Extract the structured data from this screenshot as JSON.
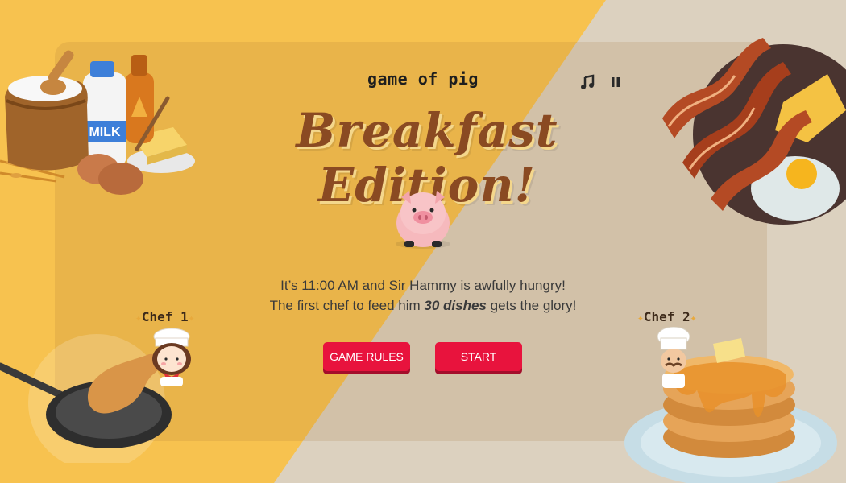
{
  "game_title": "game of pig",
  "headline": "Breakfast Edition!",
  "controls": {
    "music_icon": "music-note-icon",
    "pause_icon": "pause-icon"
  },
  "intro": {
    "line1": "It’s 11:00 AM and Sir Hammy is awfully hungry!",
    "line2_before": "The first chef to feed him ",
    "line2_emphasis": "30 dishes",
    "line2_after": " gets the glory!"
  },
  "buttons": {
    "rules": "GAME RULES",
    "start": "START"
  },
  "players": [
    {
      "label": "Chef 1"
    },
    {
      "label": "Chef 2"
    }
  ],
  "colors": {
    "button": "#e8133d",
    "headline": "#8a4a22",
    "bg_yellow": "#f7c24f",
    "bg_beige": "#dcd1bf"
  }
}
